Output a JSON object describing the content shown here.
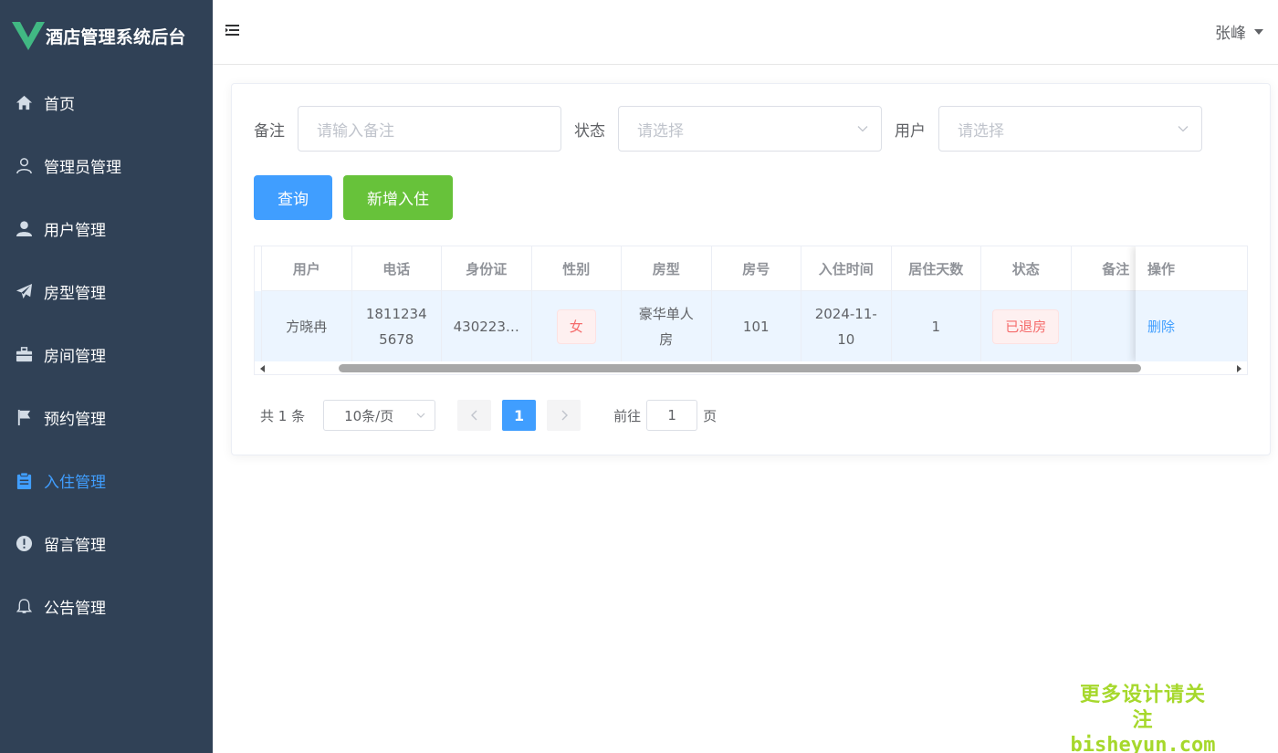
{
  "app": {
    "title": "酒店管理系统后台"
  },
  "colors": {
    "sidebar_bg": "#304156",
    "primary": "#409eff",
    "success": "#67c23a",
    "danger": "#f56c6c",
    "watermark": "#a6d82c"
  },
  "sidebar": {
    "items": [
      {
        "label": "首页",
        "icon": "home-icon",
        "active": false
      },
      {
        "label": "管理员管理",
        "icon": "user-outline-icon",
        "active": false
      },
      {
        "label": "用户管理",
        "icon": "user-icon",
        "active": false
      },
      {
        "label": "房型管理",
        "icon": "paper-plane-icon",
        "active": false
      },
      {
        "label": "房间管理",
        "icon": "suitcase-icon",
        "active": false
      },
      {
        "label": "预约管理",
        "icon": "flag-icon",
        "active": false
      },
      {
        "label": "入住管理",
        "icon": "clipboard-icon",
        "active": true
      },
      {
        "label": "留言管理",
        "icon": "warning-circle-icon",
        "active": false
      },
      {
        "label": "公告管理",
        "icon": "bell-icon",
        "active": false
      }
    ]
  },
  "header": {
    "username": "张峰"
  },
  "filters": {
    "remark_label": "备注",
    "remark_placeholder": "请输入备注",
    "status_label": "状态",
    "status_placeholder": "请选择",
    "user_label": "用户",
    "user_placeholder": "请选择"
  },
  "buttons": {
    "query": "查询",
    "add": "新增入住"
  },
  "table": {
    "columns": [
      "用户",
      "电话",
      "身份证",
      "性别",
      "房型",
      "房号",
      "入住时间",
      "居住天数",
      "状态",
      "备注"
    ],
    "action_column": "操作",
    "rows": [
      {
        "user": "方晓冉",
        "phone": "18112345678",
        "id_card": "430223…",
        "gender": "女",
        "room_type": "豪华单人房",
        "room_no": "101",
        "checkin_time": "2024-11-10",
        "days": "1",
        "status": "已退房",
        "remark": "",
        "action": "删除"
      }
    ]
  },
  "pagination": {
    "total_text": "共 1 条",
    "page_size": "10条/页",
    "current_page": "1",
    "goto_label": "前往",
    "goto_value": "1",
    "goto_suffix": "页"
  },
  "watermark": {
    "line1": "更多设计请关注",
    "line2": "bisheyun.com"
  }
}
